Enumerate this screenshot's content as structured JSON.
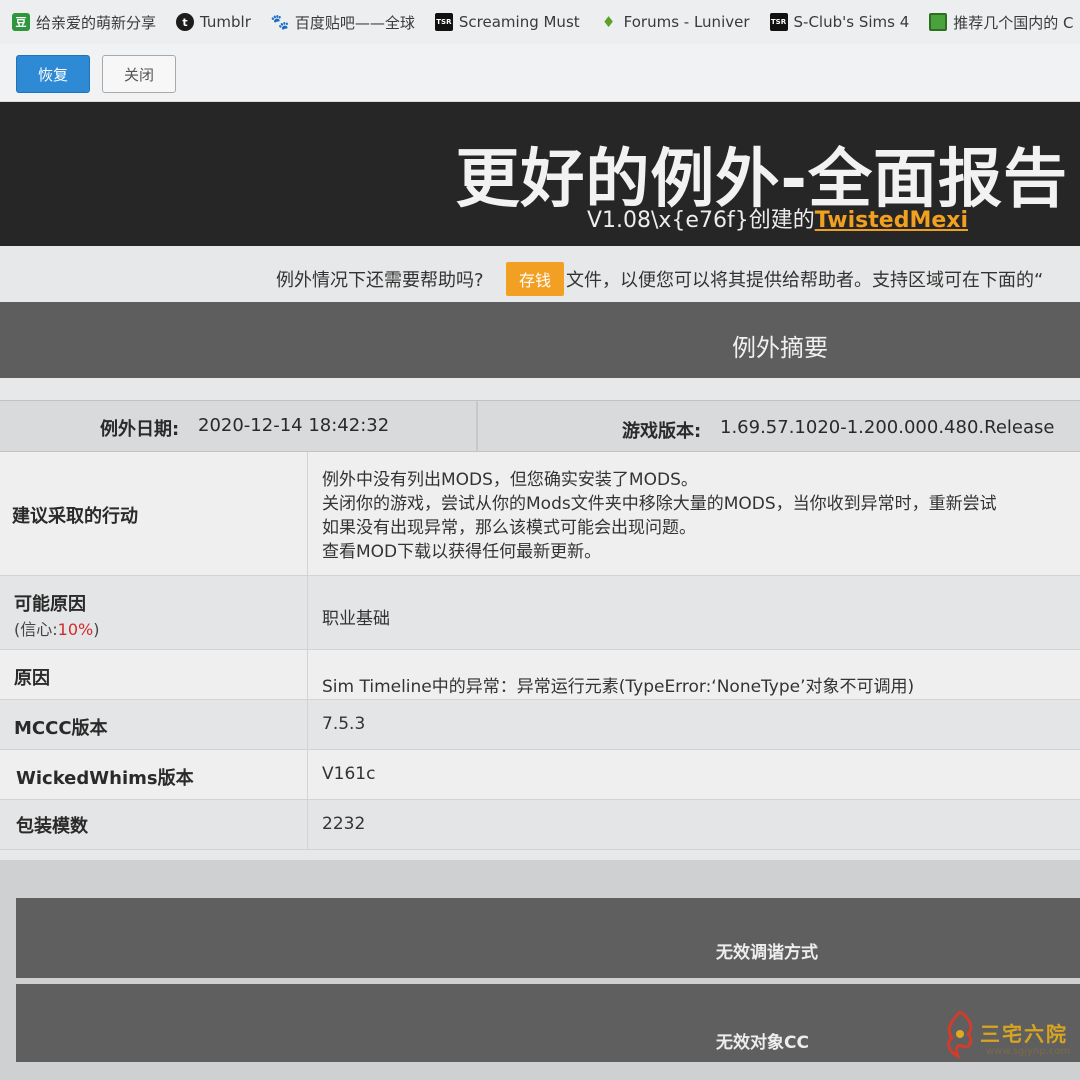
{
  "bookmarks": [
    {
      "icon": "douban-icon",
      "glyph": "豆",
      "label": "给亲爱的萌新分享"
    },
    {
      "icon": "tumblr-icon",
      "glyph": "t",
      "label": "Tumblr"
    },
    {
      "icon": "baidu-paw-icon",
      "glyph": "🐾",
      "label": "百度贴吧——全球"
    },
    {
      "icon": "tsr-icon",
      "glyph": "TSR",
      "label": "Screaming Must"
    },
    {
      "icon": "leaf-icon",
      "glyph": "♦",
      "label": "Forums - Luniver"
    },
    {
      "icon": "tsr-icon",
      "glyph": "TSR",
      "label": "S-Club's Sims 4"
    },
    {
      "icon": "minecraft-icon",
      "glyph": "",
      "label": "推荐几个国内的 C"
    }
  ],
  "toolbar": {
    "restore_label": "恢复",
    "close_label": "关闭"
  },
  "header": {
    "title": "更好的例外-全面报告",
    "subtitle_prefix": "V1.08\\x{e76f}创建的",
    "author": "TwistedMexi"
  },
  "help": {
    "prefix": "例外情况下还需要帮助吗?",
    "save_label": "存钱",
    "suffix": "文件，以便您可以将其提供给帮助者。支持区域可在下面的“"
  },
  "summary": {
    "title": "例外摘要"
  },
  "meta": {
    "date_label": "例外日期:",
    "date_value": "2020-12-14 18:42:32",
    "version_label": "游戏版本:",
    "version_value": "1.69.57.1020-1.200.000.480.Release"
  },
  "details": {
    "action_label": "建议采取的行动",
    "action_lines": [
      "例外中没有列出MODS，但您确实安装了MODS。",
      "关闭你的游戏，尝试从你的Mods文件夹中移除大量的MODS，当你收到异常时，重新尝试",
      "如果没有出现异常，那么该模式可能会出现问题。",
      "查看MOD下载以获得任何最新更新。"
    ],
    "cause_label": "可能原因",
    "confidence_prefix": "(信心:",
    "confidence_pct": "10%",
    "confidence_suffix": ")",
    "cause_value": "职业基础",
    "reason_label": "原因",
    "reason_value": "Sim Timeline中的异常：异常运行元素(TypeError:‘NoneType’对象不可调用)",
    "mccc_label": "MCCC版本",
    "mccc_value": "7.5.3",
    "ww_label": "WickedWhims版本",
    "ww_value": "V161c",
    "packages_label": "包装模数",
    "packages_value": "2232"
  },
  "accordions": {
    "invalid_tuning": "无效调谐方式",
    "invalid_cc": "无效对象CC"
  },
  "watermark": {
    "text": "三宅六院",
    "url": "www.sgjynp.com"
  },
  "colors": {
    "header_bg": "#262626",
    "accent_blue": "#2f8ad6",
    "accent_orange": "#f2a024",
    "author_orange": "#f1a020",
    "confidence_red": "#d22b2b",
    "section_gray": "#5e5e5e"
  }
}
